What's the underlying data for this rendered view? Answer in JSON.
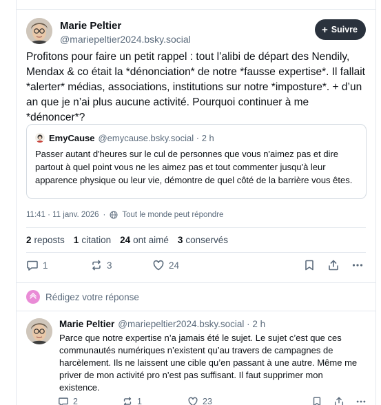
{
  "post": {
    "author_name": "Marie Peltier",
    "author_handle": "@mariepeltier2024.bsky.social",
    "follow_label": "Suivre",
    "follow_plus": "+",
    "text": "Profitons pour faire un petit rappel : tout l’alibi de départ des Nendily, Mendax & co était la *dénonciation* de notre *fausse expertise*. Il fallait *alerter* médias, associations, institutions sur notre *imposture*. + d’un an que je n’ai plus aucune activité. Pourquoi continuer à me *dénoncer*?",
    "timestamp": "11:41 · 11 janv. 2026",
    "reply_setting": "Tout le monde peut répondre"
  },
  "quote": {
    "author_name": "EmyCause",
    "author_handle": "@emycause.bsky.social · 2 h",
    "text": "Passer autant d'heures sur le cul de personnes que vous n'aimez pas et dire partout à quel point vous ne les aimez pas et tout commenter jusqu'à leur apparence physique ou leur vie, démontre de quel côté de la barrière vous êtes."
  },
  "stats": {
    "reposts_count": "2",
    "reposts_label": "reposts",
    "quotes_count": "1",
    "quotes_label": "citation",
    "likes_count": "24",
    "likes_label": "ont aimé",
    "saves_count": "3",
    "saves_label": "conservés"
  },
  "actions": {
    "reply_count": "1",
    "repost_count": "3",
    "like_count": "24"
  },
  "reply_prompt": "Rédigez votre réponse",
  "reply": {
    "author_name": "Marie Peltier",
    "author_handle": "@mariepeltier2024.bsky.social · 2 h",
    "text": "Parce que notre expertise n’a jamais été le sujet. Le sujet c’est que ces communautés numériques n’existent qu’au travers de campagnes de harcèlement. Ils ne laissent une cible qu’en passant à une autre. Même me priver de mon activité pro n’est pas suffisant. Il faut supprimer mon existence.",
    "reply_count": "2",
    "repost_count": "1",
    "like_count": "23"
  },
  "colors": {
    "accent": "#2a323d",
    "muted": "#5b6b7c",
    "border": "#e3e8ee",
    "reply_avatar": "#e98bd6"
  },
  "icons": [
    "avatar-icon",
    "globe-icon",
    "comment-icon",
    "repost-icon",
    "heart-icon",
    "bookmark-icon",
    "share-icon",
    "more-icon",
    "compose-icon"
  ]
}
